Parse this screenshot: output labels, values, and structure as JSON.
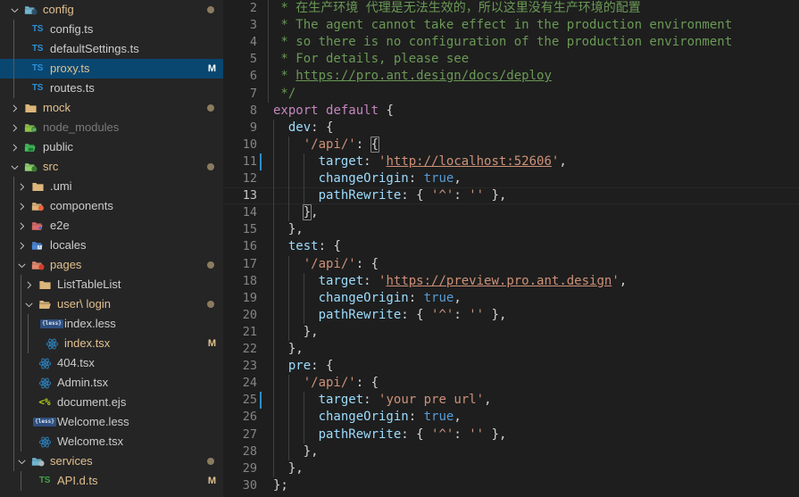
{
  "window": {
    "theme_background": "#1e1e1e",
    "sidebar_background": "#252526",
    "selection_color": "#094771",
    "accent_color": "#007acc"
  },
  "sidebar": {
    "name": "explorer-file-tree",
    "items": [
      {
        "label": "config",
        "indent": 0,
        "type": "folder-open",
        "icon": "folder-config-open-icon",
        "twisty": "chevron-down",
        "dot": true,
        "badge": ""
      },
      {
        "label": "config.ts",
        "indent": 1,
        "type": "file-ts",
        "icon": "typescript-icon",
        "twisty": "",
        "dot": false,
        "badge": ""
      },
      {
        "label": "defaultSettings.ts",
        "indent": 1,
        "type": "file-ts",
        "icon": "typescript-icon",
        "twisty": "",
        "dot": false,
        "badge": ""
      },
      {
        "label": "proxy.ts",
        "indent": 1,
        "type": "file-ts",
        "icon": "typescript-icon",
        "twisty": "",
        "dot": false,
        "badge": "M",
        "selected": true
      },
      {
        "label": "routes.ts",
        "indent": 1,
        "type": "file-ts",
        "icon": "typescript-icon",
        "twisty": "",
        "dot": false,
        "badge": ""
      },
      {
        "label": "mock",
        "indent": 0,
        "type": "folder",
        "icon": "folder-icon",
        "twisty": "chevron-right",
        "dot": true,
        "badge": ""
      },
      {
        "label": "node_modules",
        "indent": 0,
        "type": "folder-dim",
        "icon": "folder-node-icon",
        "twisty": "chevron-right",
        "dot": false,
        "badge": ""
      },
      {
        "label": "public",
        "indent": 0,
        "type": "folder",
        "icon": "folder-public-icon",
        "twisty": "chevron-right",
        "dot": false,
        "badge": ""
      },
      {
        "label": "src",
        "indent": 0,
        "type": "folder-open",
        "icon": "folder-src-open-icon",
        "twisty": "chevron-down",
        "dot": true,
        "badge": ""
      },
      {
        "label": ".umi",
        "indent": 1,
        "type": "folder",
        "icon": "folder-icon",
        "twisty": "chevron-right",
        "dot": false,
        "badge": ""
      },
      {
        "label": "components",
        "indent": 1,
        "type": "folder",
        "icon": "folder-components-icon",
        "twisty": "chevron-right",
        "dot": false,
        "badge": ""
      },
      {
        "label": "e2e",
        "indent": 1,
        "type": "folder",
        "icon": "folder-e2e-icon",
        "twisty": "chevron-right",
        "dot": false,
        "badge": ""
      },
      {
        "label": "locales",
        "indent": 1,
        "type": "folder",
        "icon": "folder-locales-icon",
        "twisty": "chevron-right",
        "dot": false,
        "badge": ""
      },
      {
        "label": "pages",
        "indent": 1,
        "type": "folder-open",
        "icon": "folder-pages-open-icon",
        "twisty": "chevron-down",
        "dot": true,
        "badge": ""
      },
      {
        "label": "ListTableList",
        "indent": 2,
        "type": "folder",
        "icon": "folder-icon",
        "twisty": "chevron-right",
        "dot": false,
        "badge": ""
      },
      {
        "label": "user\\ login",
        "indent": 2,
        "type": "folder-open",
        "icon": "folder-open-icon",
        "twisty": "chevron-down",
        "dot": true,
        "badge": ""
      },
      {
        "label": "index.less",
        "indent": 3,
        "type": "file-less",
        "icon": "less-icon",
        "twisty": "",
        "dot": false,
        "badge": ""
      },
      {
        "label": "index.tsx",
        "indent": 3,
        "type": "file-react",
        "icon": "react-icon",
        "twisty": "",
        "dot": false,
        "badge": "M"
      },
      {
        "label": "404.tsx",
        "indent": 2,
        "type": "file-react",
        "icon": "react-icon",
        "twisty": "",
        "dot": false,
        "badge": ""
      },
      {
        "label": "Admin.tsx",
        "indent": 2,
        "type": "file-react",
        "icon": "react-icon",
        "twisty": "",
        "dot": false,
        "badge": ""
      },
      {
        "label": "document.ejs",
        "indent": 2,
        "type": "file-ejs",
        "icon": "ejs-icon",
        "twisty": "",
        "dot": false,
        "badge": ""
      },
      {
        "label": "Welcome.less",
        "indent": 2,
        "type": "file-less",
        "icon": "less-icon",
        "twisty": "",
        "dot": false,
        "badge": ""
      },
      {
        "label": "Welcome.tsx",
        "indent": 2,
        "type": "file-react",
        "icon": "react-icon",
        "twisty": "",
        "dot": false,
        "badge": ""
      },
      {
        "label": "services",
        "indent": 1,
        "type": "folder-open",
        "icon": "folder-services-open-icon",
        "twisty": "chevron-down",
        "dot": true,
        "badge": ""
      },
      {
        "label": "API.d.ts",
        "indent": 2,
        "type": "file-dts",
        "icon": "typescript-def-icon",
        "twisty": "",
        "dot": false,
        "badge": "M"
      }
    ]
  },
  "editor": {
    "name": "code-editor-proxy-ts",
    "language": "typescript",
    "first_visible_line": 2,
    "cursor_lines": [
      11,
      25
    ],
    "active_line": 13,
    "lines": [
      {
        "n": 2,
        "text": " * 在生产环境 代理是无法生效的，所以这里没有生产环境的配置"
      },
      {
        "n": 3,
        "text": " * The agent cannot take effect in the production environment"
      },
      {
        "n": 4,
        "text": " * so there is no configuration of the production environment"
      },
      {
        "n": 5,
        "text": " * For details, please see"
      },
      {
        "n": 6,
        "text": " * https://pro.ant.design/docs/deploy"
      },
      {
        "n": 7,
        "text": " */"
      },
      {
        "n": 8,
        "text": "export default {"
      },
      {
        "n": 9,
        "text": "  dev: {"
      },
      {
        "n": 10,
        "text": "    '/api/': {"
      },
      {
        "n": 11,
        "text": "      target: 'http://localhost:52606',"
      },
      {
        "n": 12,
        "text": "      changeOrigin: true,"
      },
      {
        "n": 13,
        "text": "      pathRewrite: { '^': '' },"
      },
      {
        "n": 14,
        "text": "    },"
      },
      {
        "n": 15,
        "text": "  },"
      },
      {
        "n": 16,
        "text": "  test: {"
      },
      {
        "n": 17,
        "text": "    '/api/': {"
      },
      {
        "n": 18,
        "text": "      target: 'https://preview.pro.ant.design',"
      },
      {
        "n": 19,
        "text": "      changeOrigin: true,"
      },
      {
        "n": 20,
        "text": "      pathRewrite: { '^': '' },"
      },
      {
        "n": 21,
        "text": "    },"
      },
      {
        "n": 22,
        "text": "  },"
      },
      {
        "n": 23,
        "text": "  pre: {"
      },
      {
        "n": 24,
        "text": "    '/api/': {"
      },
      {
        "n": 25,
        "text": "      target: 'your pre url',"
      },
      {
        "n": 26,
        "text": "      changeOrigin: true,"
      },
      {
        "n": 27,
        "text": "      pathRewrite: { '^': '' },"
      },
      {
        "n": 28,
        "text": "    },"
      },
      {
        "n": 29,
        "text": "  },"
      },
      {
        "n": 30,
        "text": "};"
      }
    ]
  }
}
